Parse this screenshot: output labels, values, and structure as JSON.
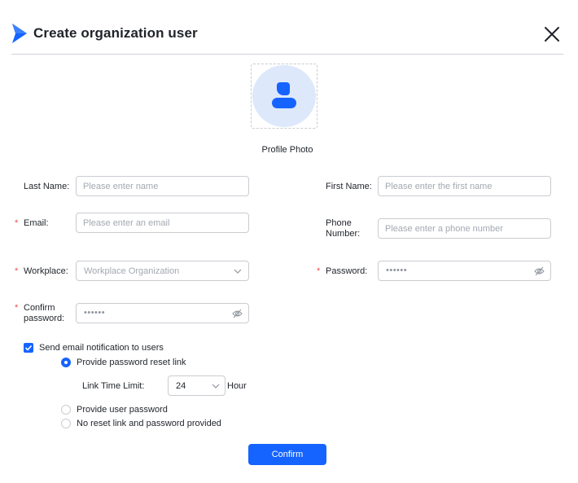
{
  "dialog": {
    "title": "Create organization user"
  },
  "profile": {
    "label": "Profile Photo"
  },
  "form": {
    "last_name": {
      "label": "Last Name:",
      "placeholder": "Please enter name"
    },
    "first_name": {
      "label": "First Name:",
      "placeholder": "Please enter the first name"
    },
    "email": {
      "required_mark": "*",
      "label": "Email:",
      "placeholder": "Please enter an email"
    },
    "phone": {
      "label_line1": "Phone",
      "label_line2": "Number:",
      "placeholder": "Please enter a phone number"
    },
    "workplace": {
      "required_mark": "*",
      "label": "Workplace:",
      "placeholder": "Workplace Organization"
    },
    "password": {
      "required_mark": "*",
      "label": "Password:",
      "value": "••••••"
    },
    "confirm_password": {
      "required_mark": "*",
      "label_line1": "Confirm",
      "label_line2": "password:",
      "value": "••••••"
    }
  },
  "notification": {
    "checkbox_label": "Send email notification to users",
    "checked": true,
    "options": [
      {
        "label": "Provide password reset link",
        "selected": true
      },
      {
        "label": "Provide user password",
        "selected": false
      },
      {
        "label": "No reset link and password provided",
        "selected": false
      }
    ],
    "link_time": {
      "label": "Link Time Limit:",
      "value": "24",
      "unit": "Hour"
    }
  },
  "actions": {
    "confirm_label": "Confirm"
  },
  "colors": {
    "primary": "#1664ff",
    "required": "#f54a45",
    "avatar_bg": "#dde8fb"
  }
}
